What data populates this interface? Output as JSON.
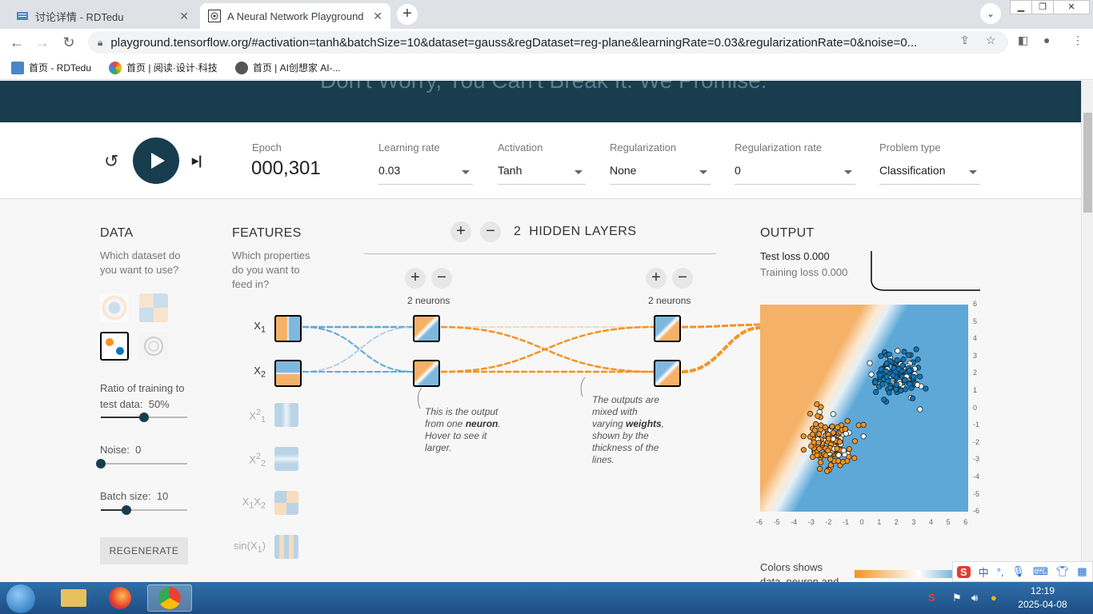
{
  "browser": {
    "tabs": [
      {
        "title": "讨论详情 - RDTedu",
        "active": false
      },
      {
        "title": "A Neural Network Playground",
        "active": true
      }
    ],
    "url": "playground.tensorflow.org/#activation=tanh&batchSize=10&dataset=gauss&regDataset=reg-plane&learningRate=0.03&regularizationRate=0&noise=0...",
    "bookmarks": [
      "首页 - RDTedu",
      "首页 | 阅读·设计·科技",
      "首页 | AI创想家 AI-..."
    ]
  },
  "header": {
    "tagline": "Don't Worry, You Can't Break It. We Promise."
  },
  "controls": {
    "epoch_label": "Epoch",
    "epoch_value": "000,301",
    "learning_rate": {
      "label": "Learning rate",
      "value": "0.03"
    },
    "activation": {
      "label": "Activation",
      "value": "Tanh"
    },
    "regularization": {
      "label": "Regularization",
      "value": "None"
    },
    "regularization_rate": {
      "label": "Regularization rate",
      "value": "0"
    },
    "problem_type": {
      "label": "Problem type",
      "value": "Classification"
    }
  },
  "data_panel": {
    "title": "DATA",
    "subtitle": "Which dataset do you want to use?",
    "ratio_label": "Ratio of training to test data:",
    "ratio_value": "50%",
    "ratio_fraction": 0.5,
    "noise_label": "Noise:",
    "noise_value": "0",
    "noise_fraction": 0,
    "batch_label": "Batch size:",
    "batch_value": "10",
    "batch_fraction": 0.3,
    "regenerate": "REGENERATE"
  },
  "features_panel": {
    "title": "FEATURES",
    "subtitle": "Which properties do you want to feed in?",
    "features": [
      {
        "base": "X",
        "sub": "1",
        "sup": "",
        "active": true
      },
      {
        "base": "X",
        "sub": "2",
        "sup": "",
        "active": true
      },
      {
        "base": "X",
        "sub": "1",
        "sup": "2",
        "active": false
      },
      {
        "base": "X",
        "sub": "2",
        "sup": "2",
        "active": false
      },
      {
        "base": "X",
        "sub": "1",
        "sup": "",
        "base2": "X",
        "sub2": "2",
        "active": false
      },
      {
        "base": "sin(X",
        "sub": "1",
        "sup": "",
        "suffix": ")",
        "active": false
      }
    ]
  },
  "network": {
    "hidden_layers_count": "2",
    "hidden_layers_label": "HIDDEN LAYERS",
    "layer1_neurons": "2 neurons",
    "layer2_neurons": "2 neurons",
    "annotation1": {
      "pre": "This is the output from one ",
      "bold": "neuron",
      "post": ". Hover to see it larger."
    },
    "annotation2": {
      "pre": "The outputs are mixed with varying ",
      "bold": "weights",
      "post": ", shown by the thickness of the lines."
    }
  },
  "output_panel": {
    "title": "OUTPUT",
    "test_loss_label": "Test loss",
    "test_loss_value": "0.000",
    "training_loss_label": "Training loss",
    "training_loss_value": "0.000",
    "colors_label": "Colors shows data, neuron and",
    "y_ticks": [
      "6",
      "5",
      "4",
      "3",
      "2",
      "1",
      "0",
      "-1",
      "-2",
      "-3",
      "-4",
      "-5",
      "-6"
    ],
    "x_ticks": [
      "-6",
      "-5",
      "-4",
      "-3",
      "-2",
      "-1",
      "0",
      "1",
      "2",
      "3",
      "4",
      "5",
      "6"
    ],
    "colors": {
      "positive": "#0877bd",
      "negative": "#f59322"
    }
  },
  "taskbar": {
    "time": "12:19",
    "date": "2025-04-08"
  },
  "ime": {
    "lang": "中"
  }
}
